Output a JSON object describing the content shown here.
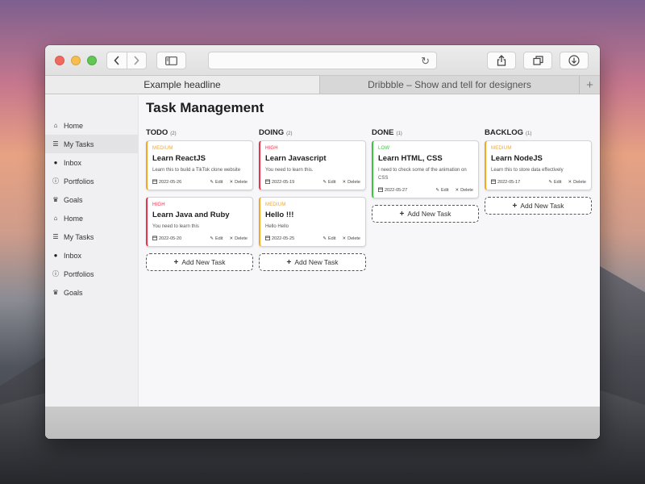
{
  "colors": {
    "medium": "#f5a623",
    "high": "#e8334a",
    "low": "#3cc63c"
  },
  "browser": {
    "reload_icon": "↻",
    "tabs": [
      {
        "label": "Example headline"
      },
      {
        "label": "Dribbble – Show and tell for designers"
      }
    ],
    "new_tab_icon": "+"
  },
  "sidebar": {
    "items": [
      {
        "label": "Home",
        "icon": "home-icon"
      },
      {
        "label": "My Tasks",
        "icon": "list-icon"
      },
      {
        "label": "Inbox",
        "icon": "chat-icon"
      },
      {
        "label": "Portfolios",
        "icon": "info-icon"
      },
      {
        "label": "Goals",
        "icon": "trophy-icon"
      },
      {
        "label": "Home",
        "icon": "home-icon"
      },
      {
        "label": "My Tasks",
        "icon": "list-icon"
      },
      {
        "label": "Inbox",
        "icon": "chat-icon"
      },
      {
        "label": "Portfolios",
        "icon": "info-icon"
      },
      {
        "label": "Goals",
        "icon": "trophy-icon"
      }
    ]
  },
  "main": {
    "title": "Task Management",
    "add_label": "Add New Task",
    "edit_label": "Edit",
    "delete_label": "Delete",
    "columns": [
      {
        "name": "TODO",
        "count": "(2)",
        "cards": [
          {
            "priority": "MEDIUM",
            "title": "Learn ReactJS",
            "desc": "Learn this to build a TikTok clone website",
            "date": "2022-05-26"
          },
          {
            "priority": "HIGH",
            "title": "Learn Java and Ruby",
            "desc": "You need to learn this",
            "date": "2022-05-20"
          }
        ]
      },
      {
        "name": "DOING",
        "count": "(2)",
        "cards": [
          {
            "priority": "HIGH",
            "title": "Learn Javascript",
            "desc": "You need to learn this.",
            "date": "2022-05-19"
          },
          {
            "priority": "MEDIUM",
            "title": "Hello !!!",
            "desc": "Hello Hello",
            "date": "2022-05-25"
          }
        ]
      },
      {
        "name": "DONE",
        "count": "(1)",
        "cards": [
          {
            "priority": "LOW",
            "title": "Learn HTML, CSS",
            "desc": "I need to check some of the animation on CSS",
            "date": "2022-05-27"
          }
        ]
      },
      {
        "name": "BACKLOG",
        "count": "(1)",
        "cards": [
          {
            "priority": "MEDIUM",
            "title": "Learn NodeJS",
            "desc": "Learn this to store data effectively",
            "date": "2022-05-17"
          }
        ]
      }
    ]
  }
}
